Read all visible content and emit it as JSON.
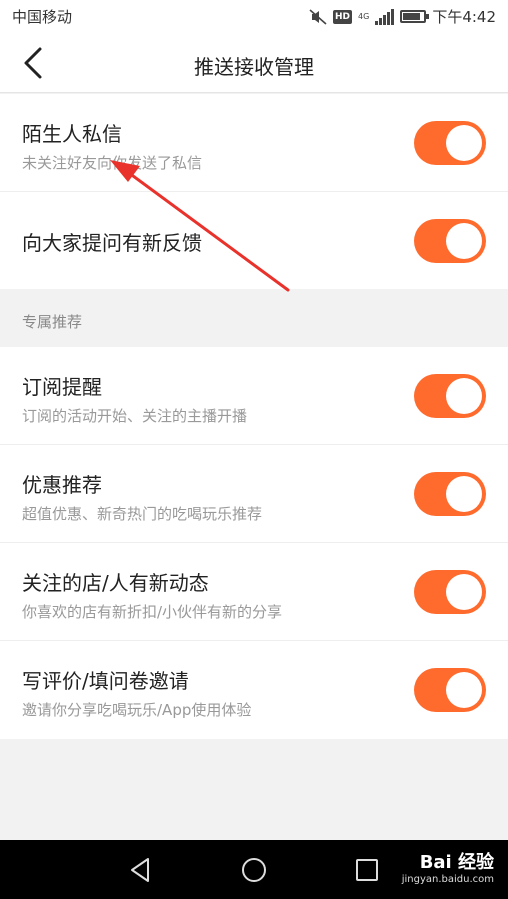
{
  "status_bar": {
    "carrier": "中国移动",
    "network": "4G",
    "hd": "HD",
    "time": "下午4:42",
    "battery_level": 0.85
  },
  "nav": {
    "title": "推送接收管理"
  },
  "group1": {
    "items": [
      {
        "title": "陌生人私信",
        "subtitle": "未关注好友向你发送了私信",
        "enabled": true
      },
      {
        "title": "向大家提问有新反馈",
        "subtitle": "",
        "enabled": true
      }
    ]
  },
  "section": {
    "title": "专属推荐"
  },
  "group2": {
    "items": [
      {
        "title": "订阅提醒",
        "subtitle": "订阅的活动开始、关注的主播开播",
        "enabled": true
      },
      {
        "title": "优惠推荐",
        "subtitle": "超值优惠、新奇热门的吃喝玩乐推荐",
        "enabled": true
      },
      {
        "title": "关注的店/人有新动态",
        "subtitle": "你喜欢的店有新折扣/小伙伴有新的分享",
        "enabled": true
      },
      {
        "title": "写评价/填问卷邀请",
        "subtitle": "邀请你分享吃喝玩乐/App使用体验",
        "enabled": true
      }
    ]
  },
  "colors": {
    "toggle_on": "#ff6a2d",
    "annotation": "#e8322b"
  },
  "watermark": {
    "logo": "Bai 经验",
    "url": "jingyan.baidu.com"
  }
}
